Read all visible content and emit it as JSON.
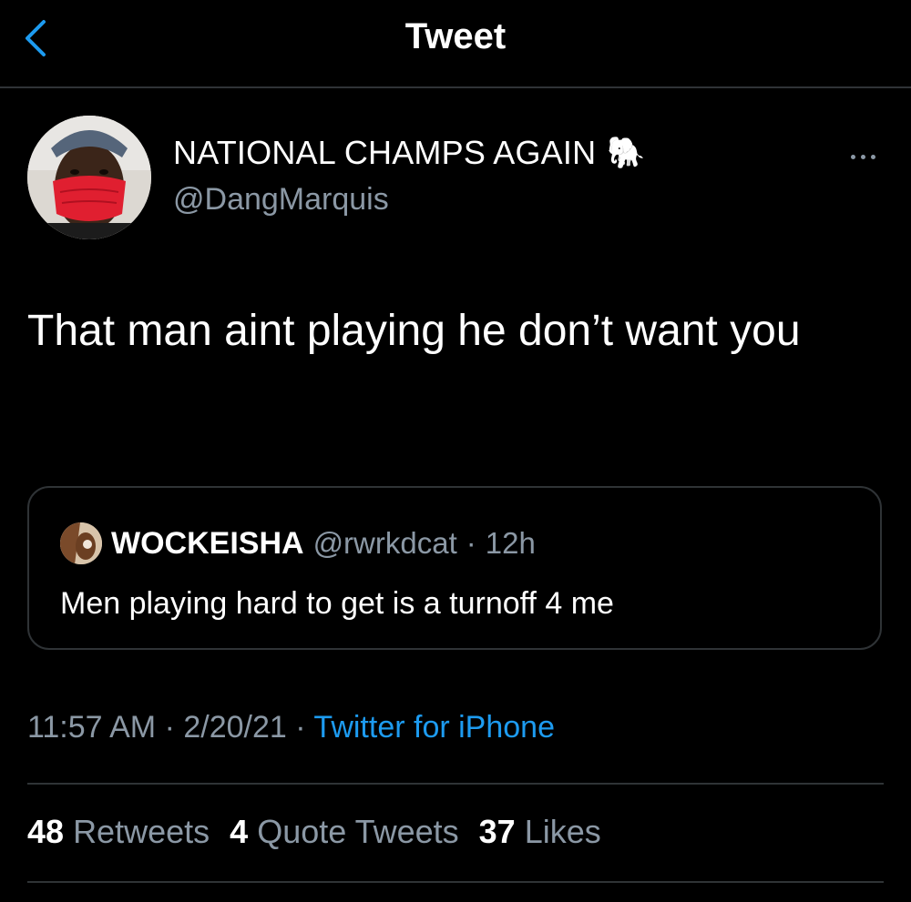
{
  "header": {
    "title": "Tweet",
    "back_icon": "chevron-left-icon",
    "accent_color": "#1d9bf0"
  },
  "author": {
    "display_name": "NATIONAL CHAMPS AGAIN",
    "emoji": "🐘",
    "handle": "@DangMarquis"
  },
  "tweet": {
    "text": "That man aint playing he don’t want you"
  },
  "quote": {
    "name": "WOCKEISHA",
    "handle": "@rwrkdcat",
    "separator": "·",
    "time": "12h",
    "text": "Men playing hard to get is a turnoff 4 me"
  },
  "meta": {
    "time": "11:57 AM",
    "sep1": " · ",
    "date": "2/20/21",
    "sep2": " · ",
    "source": "Twitter for iPhone"
  },
  "stats": {
    "retweets_count": "48",
    "retweets_label": "Retweets",
    "quotes_count": "4",
    "quotes_label": "Quote Tweets",
    "likes_count": "37",
    "likes_label": "Likes"
  }
}
